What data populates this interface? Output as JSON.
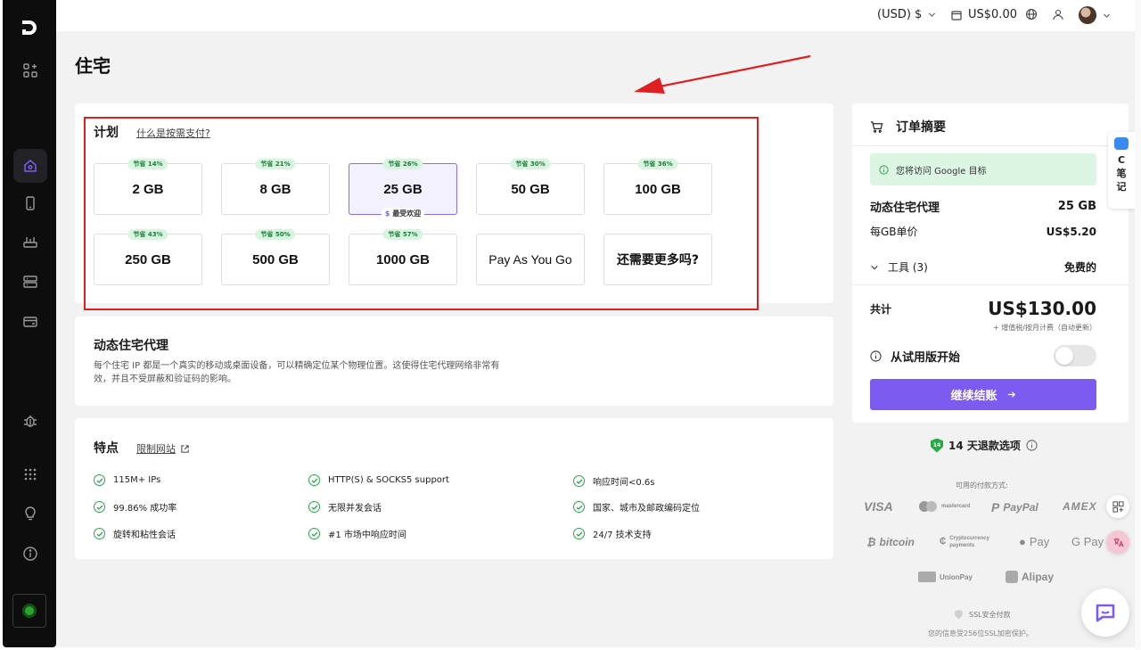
{
  "topbar": {
    "currency": "(USD) $",
    "cart_amount": "US$0.00"
  },
  "page": {
    "title": "住宅"
  },
  "plans": {
    "title": "计划",
    "help_link": "什么是按需支付?",
    "popular_label": "最受欢迎",
    "tiles": [
      {
        "label": "2 GB",
        "discount": "节省 14%"
      },
      {
        "label": "8 GB",
        "discount": "节省 21%"
      },
      {
        "label": "25 GB",
        "discount": "节省 26%",
        "selected": true
      },
      {
        "label": "50 GB",
        "discount": "节省 30%"
      },
      {
        "label": "100 GB",
        "discount": "节省 36%"
      },
      {
        "label": "250 GB",
        "discount": "节省 43%"
      },
      {
        "label": "500 GB",
        "discount": "节省 50%"
      },
      {
        "label": "1000 GB",
        "discount": "节省 57%"
      },
      {
        "label": "Pay As You Go",
        "discount": ""
      },
      {
        "label": "还需要更多吗?",
        "discount": ""
      }
    ]
  },
  "description": {
    "title": "动态住宅代理",
    "text": "每个住宅 IP 都是一个真实的移动或桌面设备，可以精确定位某个物理位置。这使得住宅代理网络非常有效，并且不受屏蔽和验证码的影响。"
  },
  "features": {
    "title": "特点",
    "link": "限制网站",
    "items": [
      "115M+ IPs",
      "HTTP(S) & SOCKS5 support",
      "响应时间<0.6s",
      "99.86% 成功率",
      "无限并发会话",
      "国家、城市及邮政编码定位",
      "旋转和粘性会话",
      "#1 市场中响应时间",
      "24/7 技术支持"
    ]
  },
  "order": {
    "title": "订单摘要",
    "notice": "您将访问 Google 目标",
    "product": "动态住宅代理",
    "product_value": "25 GB",
    "unit_label": "每GB单价",
    "unit_value": "US$5.20",
    "tools_label": "工具 (3)",
    "tools_value": "免费的",
    "total_label": "共计",
    "total_value": "US$130.00",
    "tax_note": "+ 增值税/按月计费（自动更新）",
    "trial_label": "从试用版开始",
    "trial_enabled": false,
    "checkout_label": "继续结账"
  },
  "refund": {
    "badge": "14",
    "label": "14 天退款选项"
  },
  "payments": {
    "title": "可用的付款方式:",
    "methods": [
      "VISA",
      "mastercard",
      "PayPal",
      "AMEX",
      "bitcoin",
      "Cryptocurrency payments",
      "Pay",
      "G Pay",
      "UnionPay",
      "Alipay"
    ],
    "ssl": "SSL安全付款",
    "ssl_note": "您的信息受256位SSL加密保护。"
  },
  "widgets": {
    "notes": [
      "C",
      "笔",
      "记"
    ]
  },
  "colors": {
    "accent": "#7c5cf0",
    "success": "#29a84a",
    "highlight_box": "#e02020",
    "sidebar": "#0d0d0d"
  }
}
